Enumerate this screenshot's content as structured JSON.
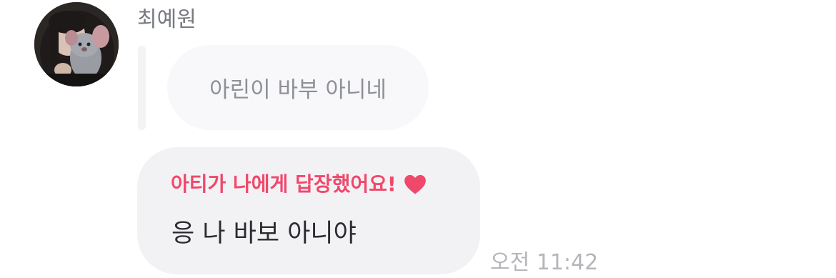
{
  "sender": {
    "name": "최예원",
    "avatar": "profile-photo"
  },
  "quoted_message": {
    "text": "아린이 바부 아니네"
  },
  "reply": {
    "header": "아티가 나에게 답장했어요!",
    "header_icon": "heart-icon",
    "text": "응 나 바보 아니야",
    "time": "오전 11:42"
  },
  "colors": {
    "accent": "#f0486b",
    "bubble": "#f2f2f5",
    "quoted_bubble": "#f8f8fa",
    "name_text": "#777a80",
    "time_text": "#b4b6bb"
  }
}
